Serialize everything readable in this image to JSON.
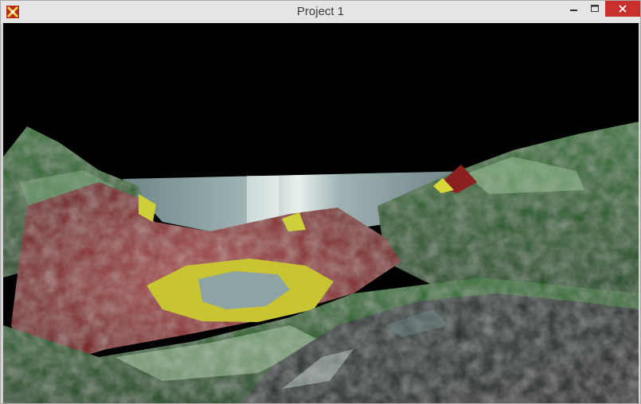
{
  "window": {
    "title": "Project 1",
    "controls": {
      "minimize_icon": "minimize-icon",
      "maximize_icon": "maximize-icon",
      "close_icon": "close-icon"
    },
    "app_icon": "app-logo-icon"
  },
  "scene": {
    "description_colors": {
      "sky": "#000000",
      "water": "#8fa4a6",
      "grass": "#1f6b1c",
      "rock_red": "#7a1414",
      "sand_yellow": "#cfcf2a",
      "highlight": "#d8e8d8"
    }
  }
}
